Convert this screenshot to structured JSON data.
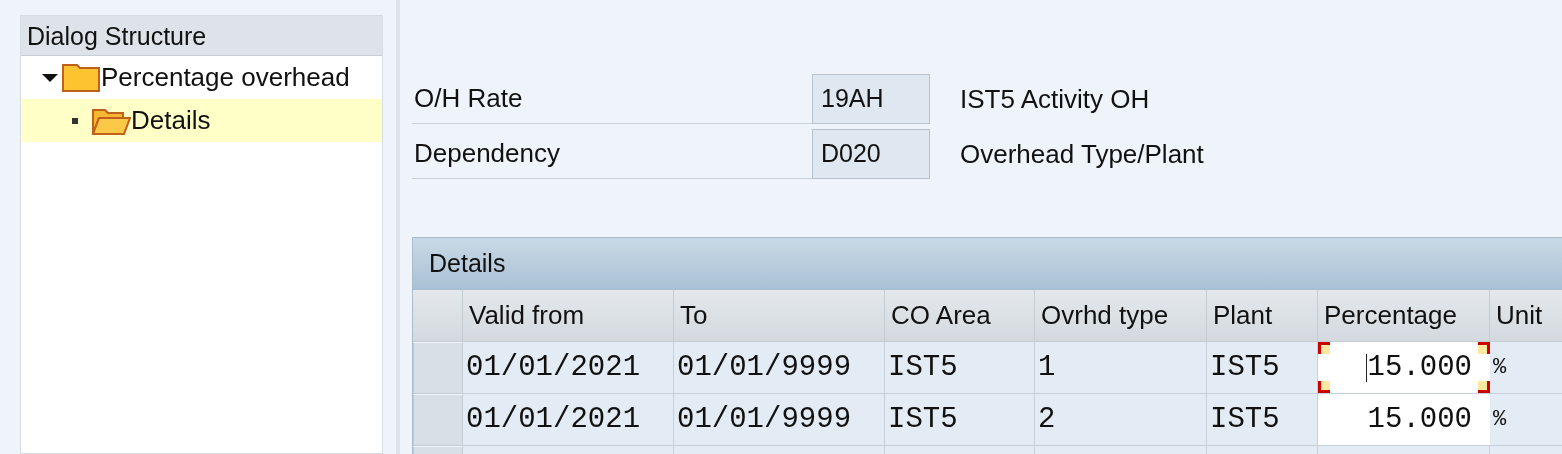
{
  "dialog_structure": {
    "title": "Dialog Structure",
    "tree": [
      {
        "label": "Percentage overhead",
        "expanded": true,
        "selected": false,
        "children": [
          {
            "label": "Details",
            "selected": true
          }
        ]
      }
    ]
  },
  "header_fields": [
    {
      "label": "O/H Rate",
      "value": "19AH",
      "description": "IST5 Activity OH"
    },
    {
      "label": "Dependency",
      "value": "D020",
      "description": "Overhead Type/Plant"
    }
  ],
  "details": {
    "title": "Details",
    "columns": [
      "Valid from",
      "To",
      "CO Area",
      "Ovrhd type",
      "Plant",
      "Percentage",
      "Unit"
    ],
    "rows": [
      {
        "cells": [
          "01/01/2021",
          "01/01/9999",
          "IST5",
          "1",
          "IST5",
          "15.000",
          "%"
        ],
        "focused": true
      },
      {
        "cells": [
          "01/01/2021",
          "01/01/9999",
          "IST5",
          "2",
          "IST5",
          "15.000",
          "%"
        ],
        "focused": false
      }
    ]
  }
}
